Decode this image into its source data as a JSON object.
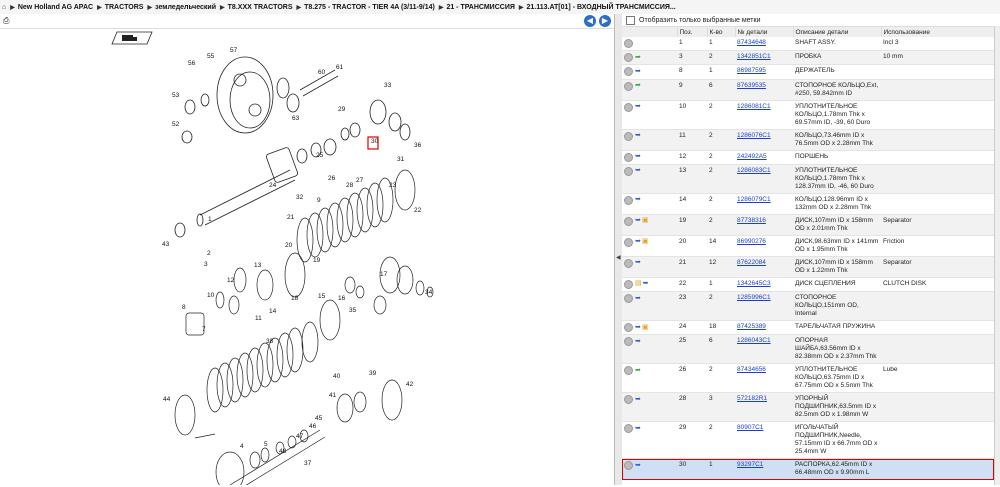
{
  "breadcrumb": [
    "New Holland AG APAC",
    "TRACTORS",
    "земледельческий",
    "T8.XXX TRACTORS",
    "T8.275 - TRACTOR - TIER 4A (3/11-9/14)",
    "21 - ТРАНСМИССИЯ",
    "21.113.AT[01] - ВХОДНЫЙ ТРАНСМИССИЯ..."
  ],
  "filter_label": "Отобразить только выбранные метки",
  "columns": [
    "Поз.",
    "К-во",
    "№ детали",
    "Описание детали",
    "Использование"
  ],
  "diagram_labels": [
    "57",
    "56",
    "55",
    "53",
    "52",
    "61",
    "60",
    "63",
    "33",
    "36",
    "31",
    "29",
    "25",
    "26",
    "28",
    "30",
    "24",
    "9",
    "32",
    "27",
    "23",
    "22",
    "1",
    "43",
    "3",
    "2",
    "21",
    "20",
    "19",
    "18",
    "12",
    "13",
    "11",
    "10",
    "8",
    "7",
    "14",
    "15",
    "16",
    "17",
    "34",
    "35",
    "38",
    "39",
    "40",
    "41",
    "42",
    "44",
    "45",
    "46",
    "47",
    "48",
    "37",
    "4",
    "5",
    "6"
  ],
  "rows": [
    {
      "pos": "1",
      "qty": "1",
      "part": "87434648",
      "desc": "SHAFT ASSY.",
      "use": "Incl 3",
      "icon": "dot"
    },
    {
      "pos": "3",
      "qty": "2",
      "part": "1342851C1",
      "desc": "ПРОБКА",
      "use": "10 mm",
      "icon": "green"
    },
    {
      "pos": "8",
      "qty": "1",
      "part": "86987595",
      "desc": "ДЕРЖАТЕЛЬ",
      "use": "",
      "icon": "blue"
    },
    {
      "pos": "9",
      "qty": "6",
      "part": "87639535",
      "desc": "СТОПОРНОЕ КОЛЬЦО,Ext, #250, 59.842mm ID",
      "use": "",
      "icon": "green"
    },
    {
      "pos": "10",
      "qty": "2",
      "part": "1286081C1",
      "desc": "УПЛОТНИТЕЛЬНОЕ КОЛЬЦО,1.78mm Thk x 69.57mm ID, -39, 60 Duro",
      "use": "",
      "icon": "blue"
    },
    {
      "pos": "11",
      "qty": "2",
      "part": "1286076C1",
      "desc": "КОЛЬЦО,73.46mm ID x 76.5mm OD x 2.28mm Thk",
      "use": "",
      "icon": "blue"
    },
    {
      "pos": "12",
      "qty": "2",
      "part": "242492A5",
      "desc": "ПОРШЕНЬ",
      "use": "",
      "icon": "blue"
    },
    {
      "pos": "13",
      "qty": "2",
      "part": "1286083C1",
      "desc": "УПЛОТНИТЕЛЬНОЕ КОЛЬЦО,1.78mm Thk x 128.37mm ID, -46, 60 Duro",
      "use": "",
      "icon": "blue"
    },
    {
      "pos": "14",
      "qty": "2",
      "part": "1286079C1",
      "desc": "КОЛЬЦО,128.96mm ID x 132mm OD x 2.28mm Thk",
      "use": "",
      "icon": "blue"
    },
    {
      "pos": "19",
      "qty": "2",
      "part": "87738316",
      "desc": "ДИСК,107mm ID x 158mm OD x 2.01mm Thk",
      "use": "Separator",
      "icon": "box"
    },
    {
      "pos": "20",
      "qty": "14",
      "part": "86990276",
      "desc": "ДИСК,98.63mm ID x 141mm OD x 1.95mm Thk",
      "use": "Friction",
      "icon": "box"
    },
    {
      "pos": "21",
      "qty": "12",
      "part": "87622084",
      "desc": "ДИСК,107mm ID x 158mm OD x 1.22mm Thk",
      "use": "Separator",
      "icon": "blue"
    },
    {
      "pos": "22",
      "qty": "1",
      "part": "1342645C3",
      "desc": "ДИСК СЦЕПЛЕНИЯ",
      "use": "CLUTCH DISK",
      "icon": "lock"
    },
    {
      "pos": "23",
      "qty": "2",
      "part": "1285996C1",
      "desc": "СТОПОРНОЕ КОЛЬЦО,151mm OD, Internal",
      "use": "",
      "icon": "blue"
    },
    {
      "pos": "24",
      "qty": "18",
      "part": "87425389",
      "desc": "ТАРЕЛЬЧАТАЯ ПРУЖИНА",
      "use": "",
      "icon": "box"
    },
    {
      "pos": "25",
      "qty": "6",
      "part": "1286043C1",
      "desc": "ОПОРНАЯ ШАЙБА,63.56mm ID x 82.38mm OD x 2.37mm Thk",
      "use": "",
      "icon": "blue"
    },
    {
      "pos": "26",
      "qty": "2",
      "part": "87434656",
      "desc": "УПЛОТНИТЕЛЬНОЕ КОЛЬЦО,63.75mm ID x 67.75mm OD x 5.5mm Thk",
      "use": "Lube",
      "icon": "green"
    },
    {
      "pos": "28",
      "qty": "3",
      "part": "572182R1",
      "desc": "УПОРНЫЙ ПОДШИПНИК,63.5mm ID x 82.5mm OD x 1.98mm W",
      "use": "",
      "icon": "blue"
    },
    {
      "pos": "29",
      "qty": "2",
      "part": "80907C1",
      "desc": "ИГОЛЬЧАТЫЙ ПОДШИПНИК,Needle, 57.15mm ID x 66.7mm OD x 25.4mm W",
      "use": "",
      "icon": "blue"
    },
    {
      "pos": "30",
      "qty": "1",
      "part": "93297C1",
      "desc": "РАСПОРКА,62.45mm ID x 66.48mm OD x 9.90mm L",
      "use": "",
      "icon": "blue",
      "selected": true
    }
  ]
}
